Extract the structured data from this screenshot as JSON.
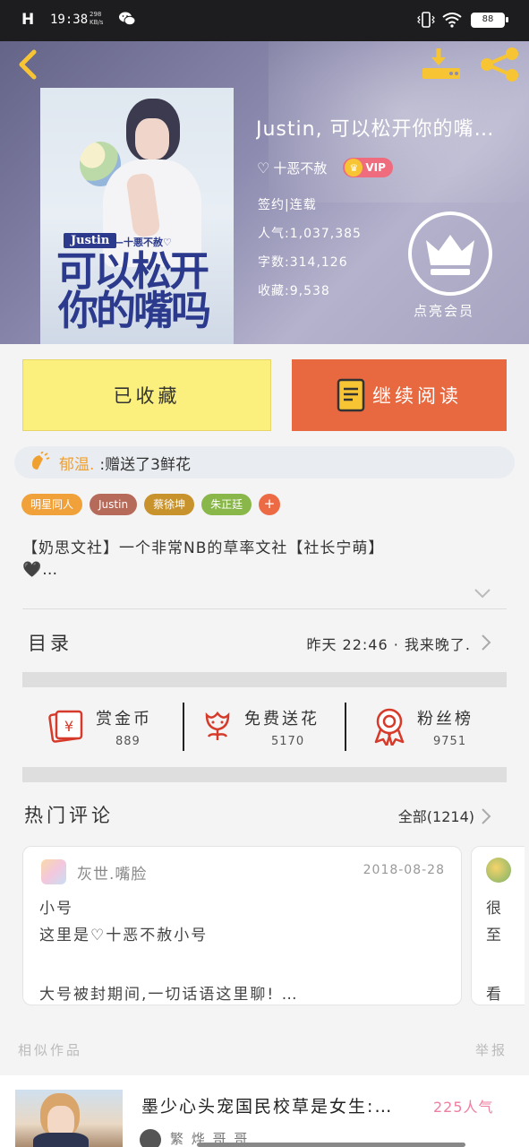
{
  "status_bar": {
    "signal": "H",
    "time": "19:38",
    "net_speed": "298",
    "net_unit": "KB/s",
    "battery": "88",
    "icons": [
      "wechat-icon",
      "vibrate-icon",
      "wifi-icon",
      "battery-icon"
    ]
  },
  "header": {
    "back_icon": "chevron-left-icon",
    "download_icon": "download-icon",
    "share_icon": "share-icon",
    "icon_color": "#f7c534"
  },
  "cover": {
    "tag": "Justin",
    "author_line": "—十悪不赦♡",
    "title_line1": "可以松开",
    "title_line2": "你的嘴吗"
  },
  "book": {
    "title": "Justin, 可以松开你的嘴…",
    "author": "十恶不赦",
    "vip_label": "VIP",
    "status": "签约|连载",
    "popularity": "人气:1,037,385",
    "word_count": "字数:314,126",
    "favorites": "收藏:9,538",
    "vip_action": "点亮会员"
  },
  "actions": {
    "collect_label": "已收藏",
    "read_label": "继续阅读",
    "collect_color": "#fbf07d",
    "read_color": "#e8683f"
  },
  "gift": {
    "user": "郁温.",
    "text": ":赠送了3鲜花"
  },
  "tags": [
    {
      "label": "明星同人",
      "color": "#f0a13a"
    },
    {
      "label": "Justin",
      "color": "#b56a5a"
    },
    {
      "label": "蔡徐坤",
      "color": "#c8922c"
    },
    {
      "label": "朱正廷",
      "color": "#89b74a"
    }
  ],
  "tag_add": "+",
  "intro": {
    "line1": "【奶思文社】一个非常NB的草率文社【社长宁萌】",
    "line2": "🖤…"
  },
  "toc": {
    "label": "目录",
    "latest": "昨天 22:46 · 我来晚了."
  },
  "stats": [
    {
      "label": "赏金币",
      "value": "889",
      "icon": "red-envelope-icon"
    },
    {
      "label": "免费送花",
      "value": "5170",
      "icon": "flower-icon"
    },
    {
      "label": "粉丝榜",
      "value": "9751",
      "icon": "medal-icon"
    }
  ],
  "comments": {
    "title": "热门评论",
    "all_label": "全部(1214)",
    "items": [
      {
        "user": "灰世.嘴脸",
        "date": "2018-08-28",
        "line1": "小号",
        "line2": "这里是♡十恶不赦小号",
        "line3": "大号被封期间,一切话语这里聊! …"
      }
    ],
    "peek": {
      "line1": "很",
      "line2": "至",
      "line3": "看"
    }
  },
  "similar": {
    "label": "相似作品",
    "report_label": "举报",
    "items": [
      {
        "title": "墨少心头宠国民校草是女生:…",
        "popularity": "225人气",
        "author": "繁 烨 哥 哥"
      }
    ]
  }
}
